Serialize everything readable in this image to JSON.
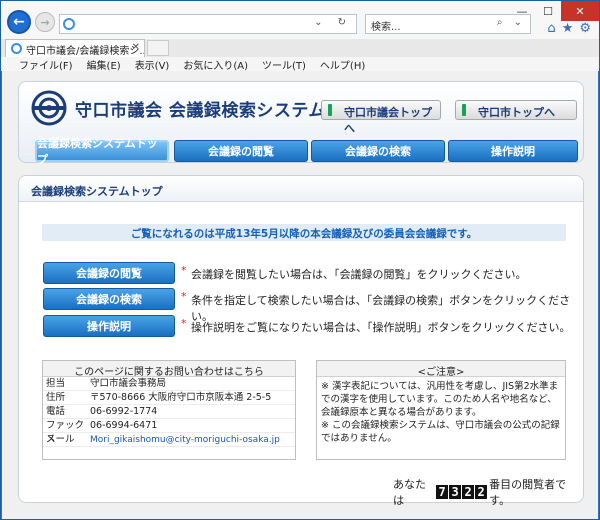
{
  "browser": {
    "search_placeholder": "検索...",
    "tab_title": "守口市議会/会議録検索シ...",
    "menu": [
      "ファイル(F)",
      "編集(E)",
      "表示(V)",
      "お気に入り(A)",
      "ツール(T)",
      "ヘルプ(H)"
    ]
  },
  "header": {
    "site_title": "守口市議会  会議録検索システム",
    "link_council_top": "守口市議会トップへ",
    "link_city_top": "守口市トップへ"
  },
  "nav": {
    "items": [
      "会議録検索システムトップ",
      "会議録の閲覧",
      "会議録の検索",
      "操作説明"
    ],
    "active_index": 0
  },
  "content": {
    "title": "会議録検索システムトップ",
    "notice": "ご覧になれるのは平成13年5月以降の本会議録及びの委員会会議録です。",
    "actions": [
      {
        "label": "会議録の閲覧",
        "description": "会議録を閲覧したい場合は、「会議録の閲覧」をクリックください。"
      },
      {
        "label": "会議録の検索",
        "description": "条件を指定して検索したい場合は、「会議録の検索」ボタンをクリックください。"
      },
      {
        "label": "操作説明",
        "description": "操作説明をご覧になりたい場合は、「操作説明」ボタンをクリックください。"
      }
    ],
    "contact": {
      "heading": "このページに関するお問い合わせはこちら",
      "rows": [
        {
          "key": "担当",
          "value": "守口市議会事務局"
        },
        {
          "key": "住所",
          "value": "〒570-8666  大阪府守口市京阪本通 2-5-5"
        },
        {
          "key": "電話",
          "value": "06-6992-1774"
        },
        {
          "key": "ファックス",
          "value": "06-6994-6471"
        },
        {
          "key": "メール",
          "value": "Mori_gikaishomu@city-moriguchi-osaka.jp"
        }
      ]
    },
    "caution": {
      "heading": "<ご注意>",
      "text1": "※ 漢字表記については、汎用性を考慮し、JIS第2水準までの漢字を使用しています。このため人名や地名など、会議録原本と異なる場合があります。",
      "text2": "※ この会議録検索システムは、守口市議会の公式の記録ではありません。"
    },
    "counter": {
      "prefix": "あなたは",
      "digits": [
        "7",
        "3",
        "2",
        "2"
      ],
      "suffix": "番目の閲覧者です。"
    }
  },
  "colors": {
    "accent": "#1a6fc0",
    "title_text": "#1a3d7a",
    "notice_text": "#1560b8"
  }
}
